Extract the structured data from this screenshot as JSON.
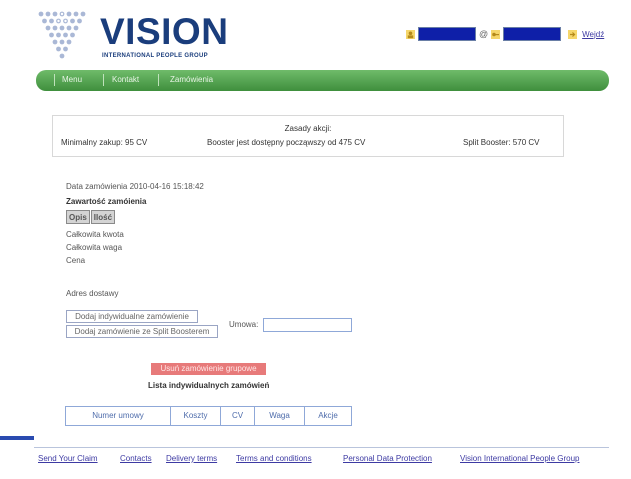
{
  "header": {
    "logo_text": "VISION",
    "logo_subtitle": "INTERNATIONAL PEOPLE GROUP",
    "login": {
      "login_value": "",
      "domain_value": "",
      "at_symbol": "@",
      "enter_link": "Wejdź"
    }
  },
  "nav": {
    "items": [
      "Menu",
      "Kontakt",
      "Zamówienia"
    ]
  },
  "rules": {
    "title": "Zasady akcji:",
    "minimum": "Minimalny zakup: 95 CV",
    "booster": "Booster jest dostępny począwszy od 475 CV",
    "split": "Split Booster: 570 CV"
  },
  "order": {
    "date": "Data zamówienia 2010-04-16 15:18:42",
    "contents_heading": "Zawartość zamóienia",
    "table_headers": [
      "Opis",
      "Ilość"
    ],
    "total_amount": "Całkowita kwota",
    "total_weight": "Całkowita waga",
    "price": "Cena",
    "address": "Adres dostawy",
    "add_individual": "Dodaj indywidualne zamówienie",
    "add_split": "Dodaj zamówienie ze Split Boosterem",
    "umowa_label": "Umowa:",
    "umowa_value": "",
    "delete_group": "Usuń zamówienie grupowe",
    "list_heading": "Lista indywidualnych zamówień",
    "list_headers": [
      "Numer umowy",
      "Koszty",
      "CV",
      "Waga",
      "Akcje"
    ]
  },
  "footer": {
    "links": [
      "Send Your Claim",
      "Contacts",
      "Delivery terms",
      "Terms and conditions",
      "Personal Data Protection",
      "Vision International People Group"
    ]
  },
  "colors": {
    "brand_blue": "#1a3d7c",
    "nav_green": "#4f9f4c",
    "delete_red": "#e77a7a",
    "link_blue": "#3d3aa3"
  }
}
